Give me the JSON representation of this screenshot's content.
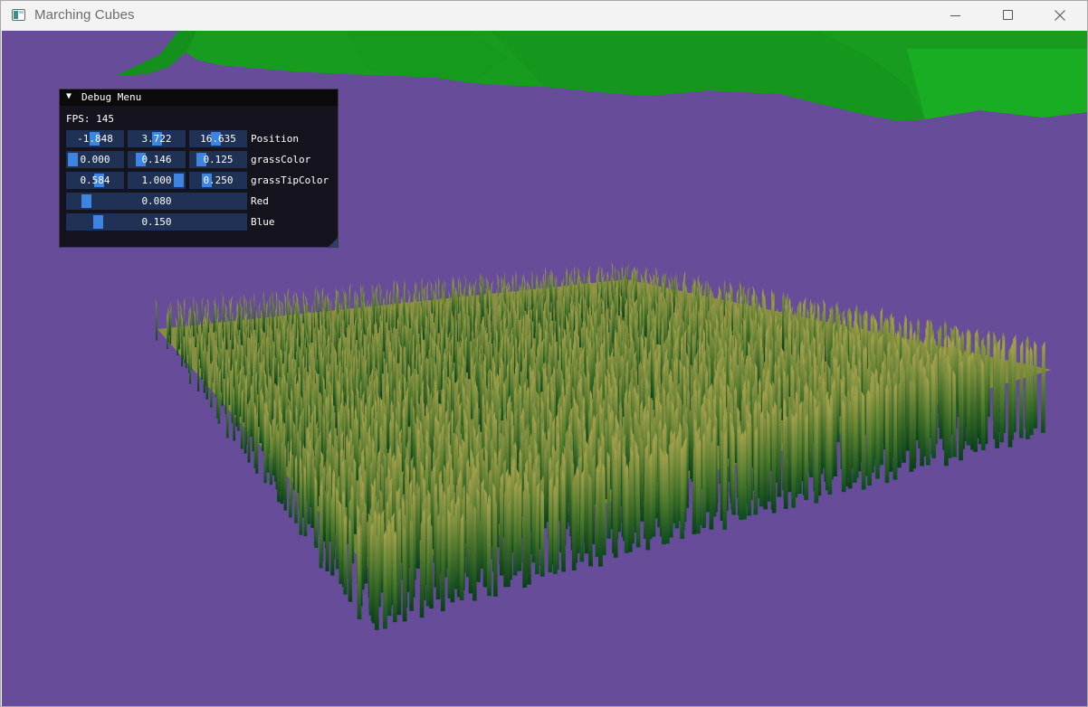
{
  "window": {
    "title": "Marching Cubes",
    "icon": "app-window-icon",
    "controls": [
      "minimize-icon",
      "maximize-icon",
      "close-icon"
    ]
  },
  "scene": {
    "background_color": "#664c99",
    "terrain_color": "#16a41c",
    "grass_base_color": "#0d4a1e",
    "grass_tip_color": "#9b9d4a"
  },
  "debug_menu": {
    "title": "Debug Menu",
    "fps_label": "FPS: 145",
    "rows": [
      {
        "label": "Position",
        "values": [
          "-1.848",
          "3.722",
          "16.635"
        ],
        "levels": [
          0.48,
          0.52,
          0.45
        ]
      },
      {
        "label": "grassColor",
        "values": [
          "0.000",
          "0.146",
          "0.125"
        ],
        "levels": [
          0.0,
          0.146,
          0.125
        ]
      },
      {
        "label": "grassTipColor",
        "values": [
          "0.584",
          "1.000",
          "0.250"
        ],
        "levels": [
          0.584,
          1.0,
          0.25
        ]
      },
      {
        "label": "Red",
        "values": [
          "0.080"
        ],
        "levels": [
          0.08
        ]
      },
      {
        "label": "Blue",
        "values": [
          "0.150"
        ],
        "levels": [
          0.15
        ]
      }
    ]
  }
}
